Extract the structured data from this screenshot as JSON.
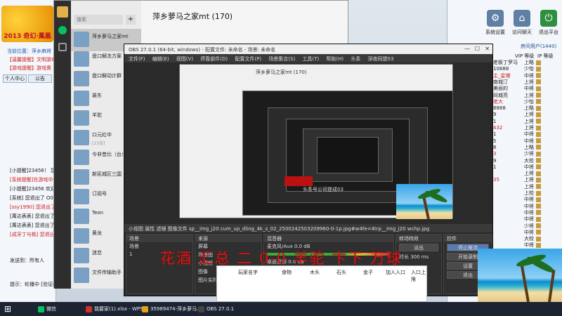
{
  "game_app": {
    "logo_text": "2013 奇幻·鳳凰",
    "line1": "当前位置：萍乡麻将",
    "line2": "【温馨提醒】文明游戏",
    "line3": "【游戏提醒】游戏需",
    "btn1": "个人中心",
    "btn2": "公告",
    "chat_lines": [
      "[小提醒]23456！ 您退出了",
      "[系统提醒]在游戏中",
      "[小提醒]23456 欢迎",
      "[系统] 您退出了 O0 ！",
      "[ssy1990] 您退出了",
      "[萬达表表] 您退出了",
      "[萬达表表] 您退出了",
      "[成牙丁与桃] 您退出了"
    ],
    "to_label": "发送到：",
    "to_value": "所有人",
    "bottom": "提示：轮播中 [验证码]"
  },
  "right_panel": {
    "icon1": "系统设置",
    "icon2": "访问聊天",
    "icon3": "退出平台",
    "tab_label": "房间用户(1440)",
    "col_vip": "VIP 等级",
    "col_lv": "IP 等级",
    "users": [
      {
        "name": "老板丁罗马",
        "lv": "上略"
      },
      {
        "name": "10888",
        "lv": "少怡"
      },
      {
        "name": "主_星爆",
        "lv": "中将"
      },
      {
        "name": "南城汀",
        "lv": "上将"
      },
      {
        "name": "美丽的",
        "lv": "中将"
      },
      {
        "name": "同城亮",
        "lv": "上将"
      },
      {
        "name": "老大",
        "lv": "少怡"
      },
      {
        "name": "8888",
        "lv": "上略"
      },
      {
        "name": "9",
        "lv": "上将"
      },
      {
        "name": "1",
        "lv": "上将"
      },
      {
        "name": "432",
        "lv": "上将"
      },
      {
        "name": "1",
        "lv": "中将"
      },
      {
        "name": "5",
        "lv": "中将"
      },
      {
        "name": "8",
        "lv": "上略"
      },
      {
        "name": "3",
        "lv": "少将"
      },
      {
        "name": "9",
        "lv": "大校"
      },
      {
        "name": "1",
        "lv": "中将"
      },
      {
        "name": "",
        "lv": "上将"
      },
      {
        "name": "35",
        "lv": "上将"
      },
      {
        "name": "",
        "lv": "上将"
      },
      {
        "name": "",
        "lv": "上校"
      },
      {
        "name": "",
        "lv": "中将"
      },
      {
        "name": "",
        "lv": "中将"
      },
      {
        "name": "",
        "lv": "中将"
      },
      {
        "name": "",
        "lv": "中将"
      },
      {
        "name": "",
        "lv": "少将"
      },
      {
        "name": "",
        "lv": "中将"
      },
      {
        "name": "",
        "lv": "大校"
      },
      {
        "name": "",
        "lv": "中将"
      },
      {
        "name": "",
        "lv": "上将"
      },
      {
        "name": "",
        "lv": "上将"
      },
      {
        "name": "",
        "lv": "中将"
      },
      {
        "name": "",
        "lv": "上将"
      },
      {
        "name": "",
        "lv": "中将"
      },
      {
        "name": "",
        "lv": "上将"
      },
      {
        "name": "",
        "lv": "中将"
      }
    ]
  },
  "wechat": {
    "search_placeholder": "搜索",
    "chat_title": "萍乡萝马之家mt (170)",
    "chats": [
      {
        "name": "萍乡萝马之家mt",
        "sub": ""
      },
      {
        "name": "盘口解冻方案",
        "sub": ""
      },
      {
        "name": "盘口解动计群",
        "sub": ""
      },
      {
        "name": "装东",
        "sub": ""
      },
      {
        "name": "羊驼",
        "sub": ""
      },
      {
        "name": "口元红中",
        "sub": "[23张]"
      },
      {
        "name": "今非昔比（台）",
        "sub": ""
      },
      {
        "name": "新民城区三国",
        "sub": ""
      },
      {
        "name": "订阅号",
        "sub": ""
      },
      {
        "name": "Teon",
        "sub": ""
      },
      {
        "name": "黄龙",
        "sub": ""
      },
      {
        "name": "迷恋",
        "sub": ""
      },
      {
        "name": "文件传输助手",
        "sub": ""
      }
    ]
  },
  "obs": {
    "title": "OBS 27.0.1 (64-bit, windows) - 配置文件: 未命名 - 场景: 未命名",
    "menu": "文件(F) 编辑(E) 视图(V) 停靠部件(D) 配置文件(P) 场景集合(S) 工具(T) 帮助(H) 头条 深夜同盟03",
    "panelbar": "小视图    属性  滤镜    图像文件  sp__img_j20 cum_up_dling_4k_s_02_2500242503209960-0-1p.jpg#w4fe=4trp__img_j20 wchp.jpg",
    "scenes_hd": "场景",
    "scenes": [
      "场景",
      "1"
    ],
    "sources_hd": "来源",
    "sources": [
      "屏幕",
      "场景图",
      "小视频",
      "图像",
      "图片实时采集"
    ],
    "mixer_hd": "混音器",
    "mixer1": "麦克风/Aux  0.0 dB",
    "mixer2": "桌面音频  0.0 dB",
    "trans_hd": "转场特效",
    "trans1": "淡出",
    "trans2": "时长  300 ms",
    "ctl_hd": "控件",
    "ctl1": "停止推流",
    "ctl2": "开始录制",
    "ctl3": "设置",
    "ctl4": "退出",
    "inner_title": "萍乡萝马之家mt (170)",
    "inner_caption": "头条号公司提成03"
  },
  "sheet": {
    "headers": [
      "玩家名字",
      "食物",
      "木头",
      "石头",
      "金子",
      "加入入口",
      "入口上限"
    ]
  },
  "overlay_text": "花酒",
  "overlay_text2": "汇总",
  "overlay_score": "二 0-0 羊驼 卞下 万球",
  "taskbar": {
    "items": [
      "微信",
      "我要家(1).xlsx - WPS",
      "35989474-萍乡萝马...",
      "OBS 27.0.1"
    ]
  }
}
